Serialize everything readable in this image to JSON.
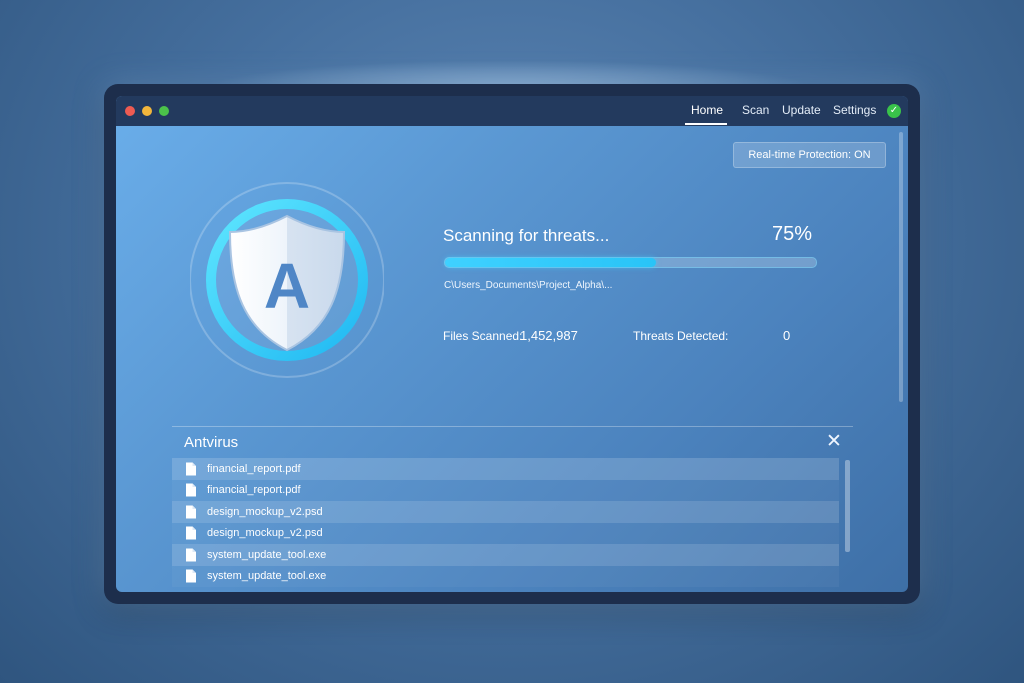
{
  "nav": {
    "items": [
      "Home",
      "Scan",
      "Update",
      "Settings"
    ],
    "active": "Home"
  },
  "status": {
    "realtime_protection": "Real-time Protection: ON"
  },
  "scan": {
    "title": "Scanning for threats...",
    "percent_label": "75%",
    "progress": 0.57,
    "current_path": "C\\Users_Documents\\Project_Alpha\\...",
    "files_scanned_label": "Files Scanned:",
    "files_scanned_value": "1,452,987",
    "threats_label": "Threats Detected:",
    "threats_value": "0"
  },
  "panel": {
    "title": "Antvirus",
    "files": [
      {
        "name": "financial_report.pdf"
      },
      {
        "name": "financial_report.pdf"
      },
      {
        "name": "design_mockup_v2.psd"
      },
      {
        "name": "design_mockup_v2.psd"
      },
      {
        "name": "system_update_tool.exe"
      },
      {
        "name": "system_update_tool.exe"
      }
    ]
  },
  "logo": {
    "letter": "A"
  },
  "colors": {
    "accent": "#2ec8f5",
    "titlebar": "#233a5e",
    "status_ok": "#39c24a"
  },
  "icons": {
    "shield": "shield-icon",
    "file": "file-icon",
    "close": "close-icon",
    "check": "check-circle-icon"
  }
}
